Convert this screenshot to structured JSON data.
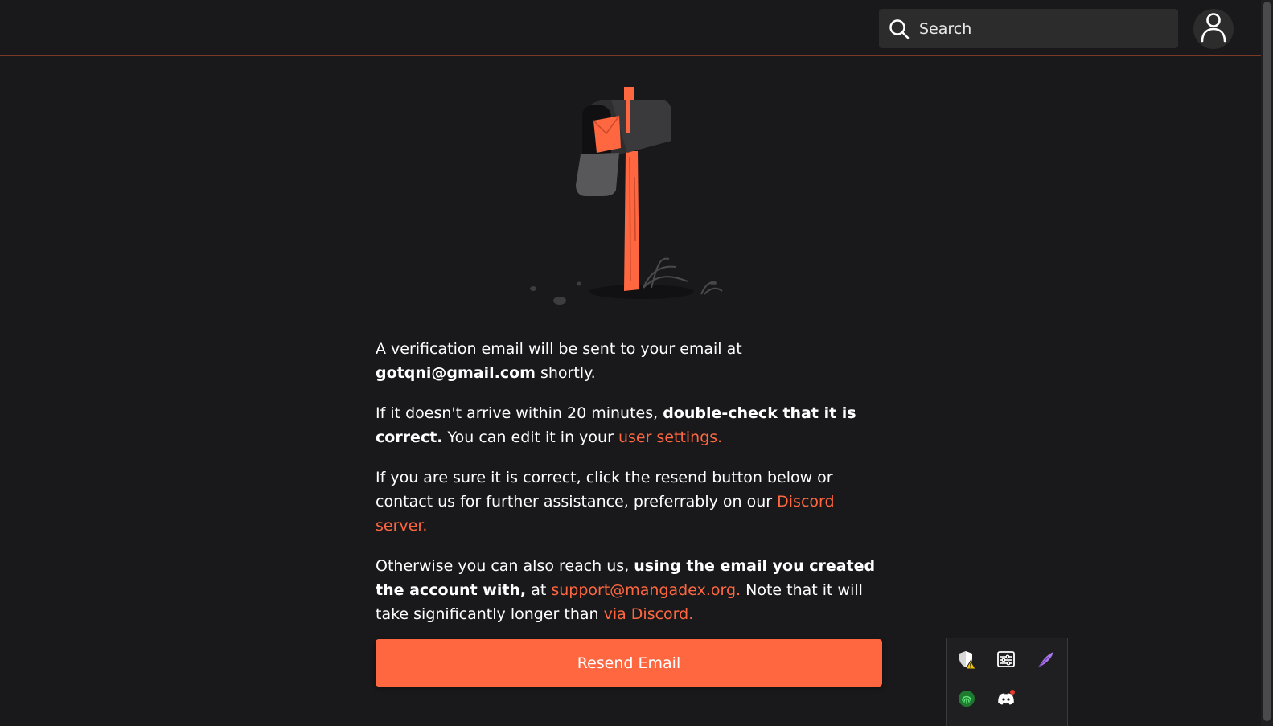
{
  "header": {
    "search_placeholder": "Search",
    "icons": {
      "search": "search-icon",
      "avatar": "user-icon"
    }
  },
  "illustration": {
    "icon": "mailbox-illustration"
  },
  "message": {
    "p1": {
      "text1": "A verification email will be sent to your email at",
      "email": "gotqni@gmail.com",
      "text2": " shortly."
    },
    "p2": {
      "text1": "If it doesn't arrive within 20 minutes, ",
      "bold": "double-check that it is correct.",
      "text2": " You can edit it in your ",
      "link": "user settings."
    },
    "p3": {
      "text1": "If you are sure it is correct, click the resend button below or contact us for further assistance, preferrably on our ",
      "link": "Discord server."
    },
    "p4": {
      "text1": "Otherwise you can also reach us, ",
      "bold": "using the email you created the account with,",
      "text2": " at ",
      "link1": "support@mangadex.org.",
      "text3": " Note that it will take significantly longer than ",
      "link2": "via Discord."
    }
  },
  "resend_button": {
    "label": "Resend Email"
  },
  "colors": {
    "accent": "#ff6740",
    "background": "#19191b",
    "surface": "#2c2c2c"
  },
  "tray": {
    "icons": [
      "shield-warning-icon",
      "settings-panel-icon",
      "feather-icon",
      "fingerprint-icon",
      "discord-icon"
    ]
  }
}
